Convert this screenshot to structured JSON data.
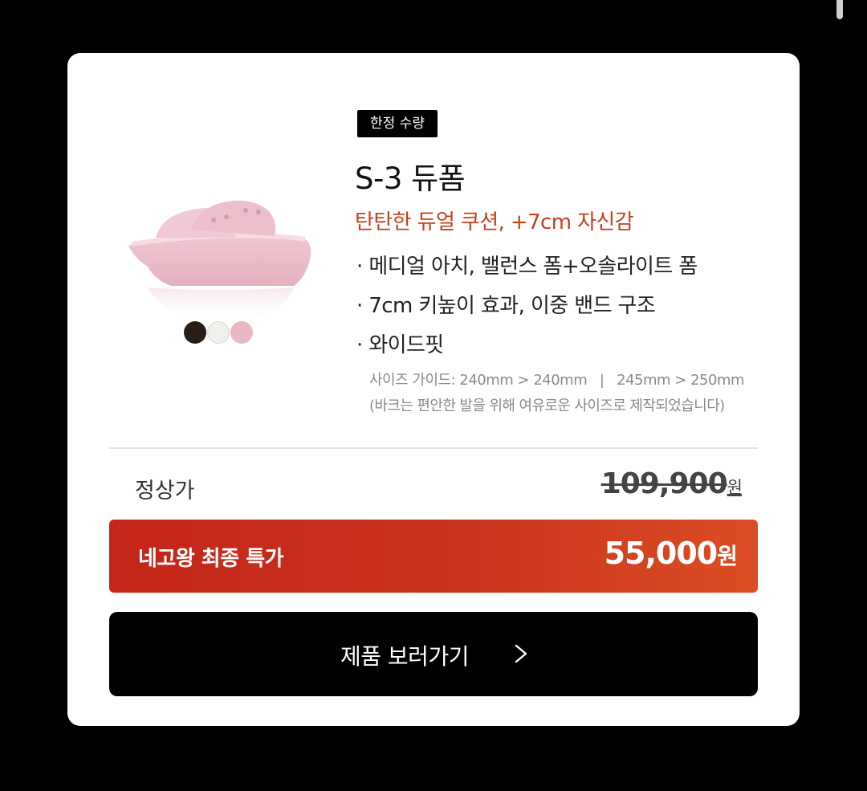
{
  "product": {
    "badge": "한정 수량",
    "name": "S-3 듀폼",
    "tagline": "탄탄한 듀얼 쿠션, +7cm 자신감",
    "features": [
      "· 메디얼 아치, 밸런스 폼+오솔라이트 폼",
      "· 7cm 키높이 효과, 이중 밴드 구조",
      "· 와이드핏"
    ],
    "size_guide": "사이즈 가이드: 240mm > 240mm   |   245mm > 250mm",
    "size_note": "(바크는 편안한 발을 위해 여유로운 사이즈로 제작되었습니다)",
    "color_swatches": [
      "#2a1d18",
      "#f1efe9",
      "#e9b8c4"
    ],
    "image_color": "#f1ccd6"
  },
  "pricing": {
    "regular_label": "정상가",
    "regular_price": "109,900",
    "regular_unit": "원",
    "final_label": "네고왕 최종 특가",
    "final_price": "55,000",
    "final_unit": "원",
    "final_color": "#c9341d"
  },
  "cta": {
    "label": "제품 보러가기",
    "icon": "chevron-right-icon"
  }
}
